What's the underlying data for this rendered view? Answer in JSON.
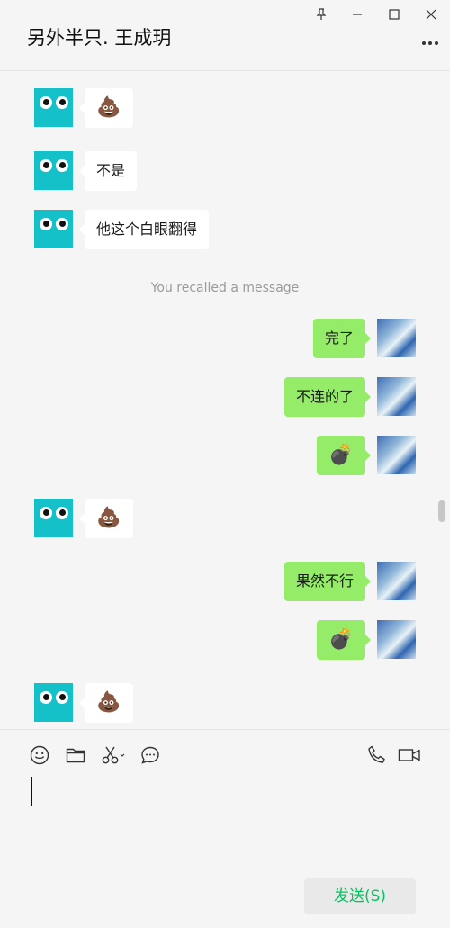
{
  "window": {
    "title": "另外半只. 王成玥",
    "controls": [
      "pin-icon",
      "minimize-icon",
      "maximize-icon",
      "close-icon"
    ],
    "more": "more-icon"
  },
  "messages": [
    {
      "side": "left",
      "type": "emoji",
      "text": "💩"
    },
    {
      "side": "left",
      "type": "text",
      "text": "不是"
    },
    {
      "side": "left",
      "type": "text",
      "text": "他这个白眼翻得"
    },
    {
      "side": "system",
      "type": "notice",
      "text": "You recalled a message"
    },
    {
      "side": "right",
      "type": "text",
      "text": "完了"
    },
    {
      "side": "right",
      "type": "text",
      "text": "不连的了"
    },
    {
      "side": "right",
      "type": "emoji",
      "text": "💣"
    },
    {
      "side": "left",
      "type": "emoji",
      "text": "💩"
    },
    {
      "side": "right",
      "type": "text",
      "text": "果然不行"
    },
    {
      "side": "right",
      "type": "emoji",
      "text": "💣"
    },
    {
      "side": "left",
      "type": "emoji",
      "text": "💩"
    }
  ],
  "toolbar": {
    "left": [
      "emoji-icon",
      "folder-icon",
      "scissors-icon",
      "chat-history-icon"
    ],
    "right": [
      "phone-icon",
      "video-call-icon"
    ]
  },
  "send_button": {
    "label": "发送(S)"
  },
  "colors": {
    "self_bubble": "#95ec69",
    "other_bubble": "#ffffff",
    "send_text": "#07c160",
    "avatar_cyan": "#14c1c9"
  }
}
